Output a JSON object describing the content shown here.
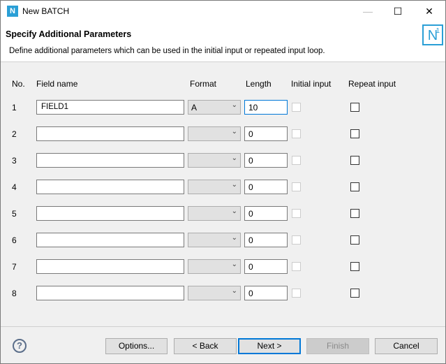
{
  "window": {
    "title": "New BATCH",
    "minimize": "—",
    "maximize": "☐",
    "close": "✕"
  },
  "header": {
    "title": "Specify Additional Parameters",
    "description": "Define additional parameters which can be used in the initial input or repeated input loop.",
    "logo": "N",
    "logo_sup": "1"
  },
  "columns": {
    "no": "No.",
    "field": "Field name",
    "format": "Format",
    "length": "Length",
    "initial": "Initial input",
    "repeat": "Repeat input"
  },
  "rows": [
    {
      "no": "1",
      "field": "FIELD1",
      "format": "A",
      "length": "10",
      "initial": false,
      "repeat": false
    },
    {
      "no": "2",
      "field": "",
      "format": "",
      "length": "0",
      "initial": false,
      "repeat": false
    },
    {
      "no": "3",
      "field": "",
      "format": "",
      "length": "0",
      "initial": false,
      "repeat": false
    },
    {
      "no": "4",
      "field": "",
      "format": "",
      "length": "0",
      "initial": false,
      "repeat": false
    },
    {
      "no": "5",
      "field": "",
      "format": "",
      "length": "0",
      "initial": false,
      "repeat": false
    },
    {
      "no": "6",
      "field": "",
      "format": "",
      "length": "0",
      "initial": false,
      "repeat": false
    },
    {
      "no": "7",
      "field": "",
      "format": "",
      "length": "0",
      "initial": false,
      "repeat": false
    },
    {
      "no": "8",
      "field": "",
      "format": "",
      "length": "0",
      "initial": false,
      "repeat": false
    }
  ],
  "buttons": {
    "help": "?",
    "options": "Options...",
    "back": "< Back",
    "next": "Next >",
    "finish": "Finish",
    "cancel": "Cancel"
  }
}
